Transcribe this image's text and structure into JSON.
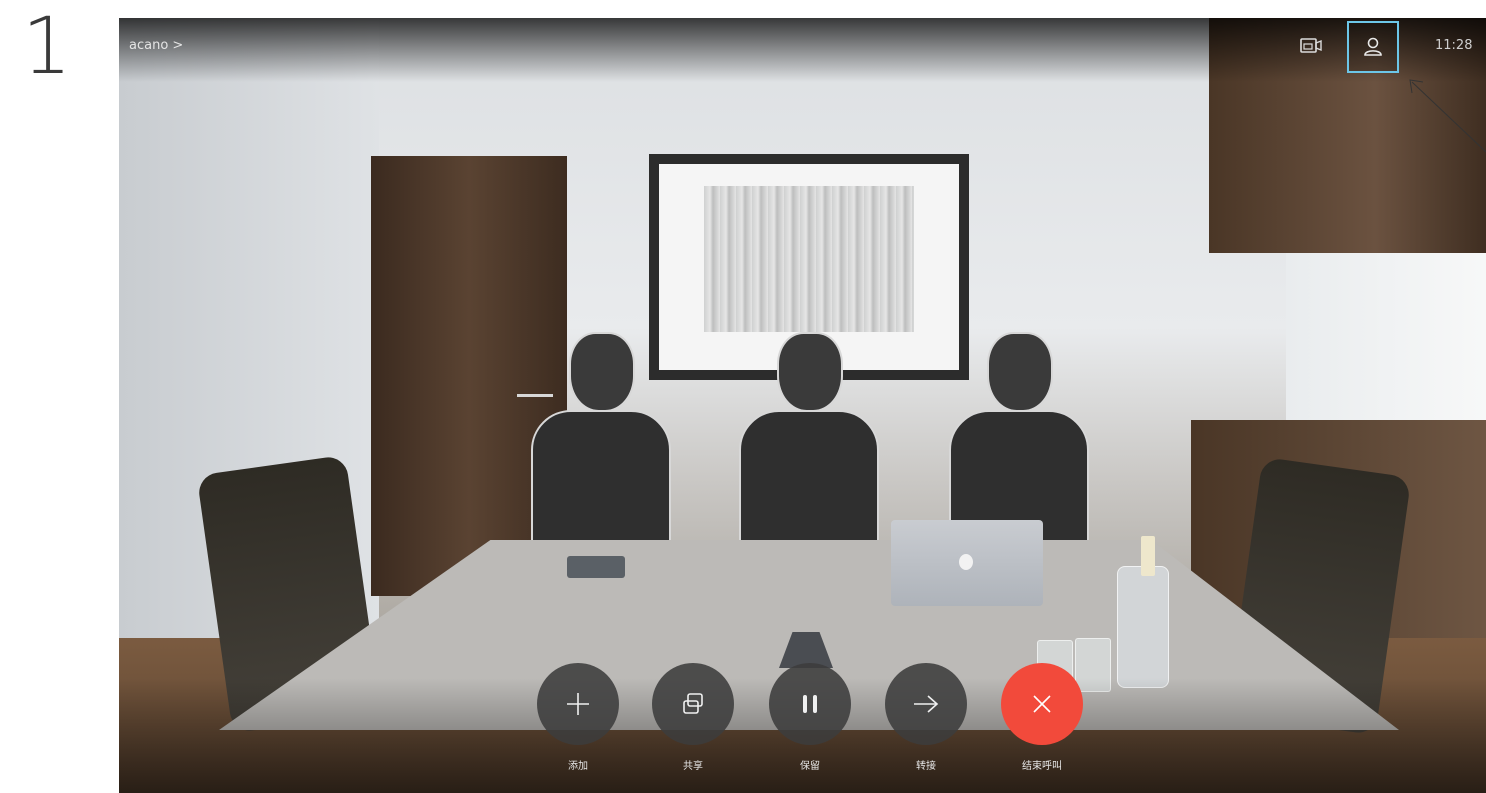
{
  "step": {
    "number": "1"
  },
  "call": {
    "title": "acano >",
    "clock": "11:28"
  },
  "controls": [
    {
      "id": "add",
      "label": "添加",
      "icon": "plus-icon"
    },
    {
      "id": "share",
      "label": "共享",
      "icon": "share-screen-icon"
    },
    {
      "id": "hold",
      "label": "保留",
      "icon": "pause-icon"
    },
    {
      "id": "transfer",
      "label": "转接",
      "icon": "arrow-right-icon"
    },
    {
      "id": "end",
      "label": "结束呼叫",
      "icon": "close-icon"
    }
  ],
  "colors": {
    "highlight": "#6cc6e8",
    "end_call": "#f24a3b",
    "control_bg": "#3c3c3c"
  },
  "icons": {
    "selfview": "selfview-icon",
    "participants": "participants-icon"
  }
}
